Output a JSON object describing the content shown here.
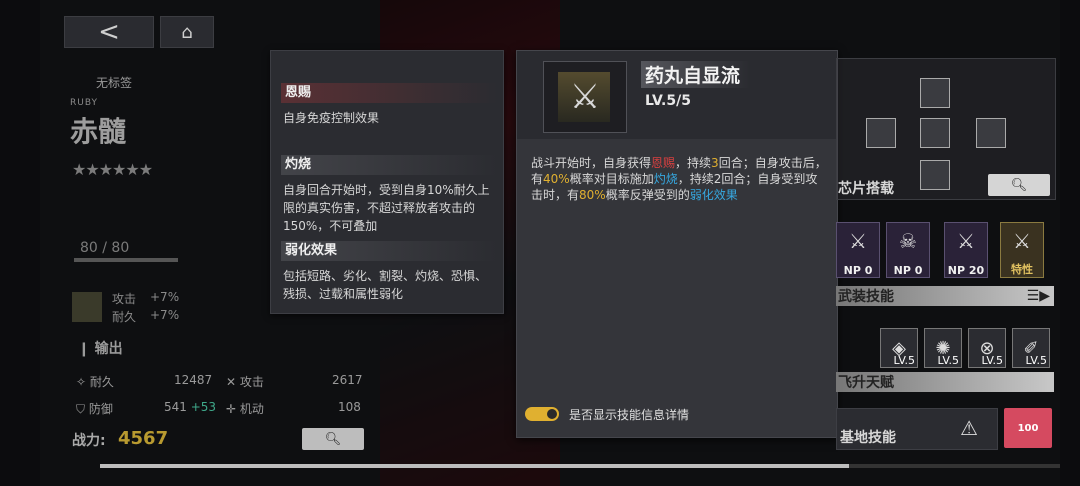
{
  "nav": {
    "back_label": "<",
    "home_icon": "home-icon"
  },
  "character": {
    "tag": "无标签",
    "en_name": "RUBY",
    "cn_name": "赤髓",
    "stars": "★★★★★★",
    "level_text": "80 / 80",
    "bonus_attack_label": "攻击",
    "bonus_attack_value": "+7%",
    "bonus_dur_label": "耐久",
    "bonus_dur_value": "+7%",
    "role": "输出",
    "stats": {
      "durability_label": "耐久",
      "durability_value": "12487",
      "attack_label": "攻击",
      "attack_value": "2617",
      "defense_label": "防御",
      "defense_value": "541",
      "defense_bonus": "+53",
      "mobility_label": "机动",
      "mobility_value": "108"
    },
    "power_label": "战力:",
    "power_value": "4567"
  },
  "tooltip": {
    "sections": [
      {
        "title": "恩赐",
        "body": "自身免疫控制效果"
      },
      {
        "title": "灼烧",
        "body": "自身回合开始时，受到自身10%耐久上限的真实伤害，不超过释放者攻击的150%，不可叠加"
      },
      {
        "title": "弱化效果",
        "body": "包括短路、劣化、割裂、灼烧、恐惧、残损、过载和属性弱化"
      }
    ]
  },
  "skill": {
    "name": "药丸自显流",
    "level": "LV.5/5",
    "desc": {
      "p1": "战斗开始时，自身获得",
      "k1": "恩赐",
      "p2": "，持续",
      "n1": "3",
      "p3": "回合；自身攻击后，有",
      "n2": "40%",
      "p4": "概率对目标施加",
      "k2": "灼烧",
      "p5": "，持续2回合；自身受到攻击时，有",
      "n3": "80%",
      "p6": "概率反弹受到的",
      "k3": "弱化效果"
    },
    "toggle_label": "是否显示技能信息详情",
    "toggle_on": true
  },
  "right": {
    "chip_title": "芯片搭载",
    "armed_title": "武装技能",
    "skill_cards": [
      {
        "label": "NP",
        "value": "0",
        "lv": "LV.5"
      },
      {
        "label": "NP",
        "value": "0",
        "lv": "LV.5"
      },
      {
        "label": "NP",
        "value": "20",
        "lv": "LV.5"
      },
      {
        "label": "特性",
        "value": "",
        "lv": "LV.5"
      }
    ],
    "ascend_title": "飞升天赋",
    "talents": [
      "LV.5",
      "LV.5",
      "LV.5",
      "LV.5"
    ],
    "base_title": "基地技能",
    "heart_value": "100"
  },
  "colors": {
    "accent_gold": "#e0b030",
    "red": "#d84040",
    "blue": "#36a8e0",
    "heart": "#d54a60"
  }
}
